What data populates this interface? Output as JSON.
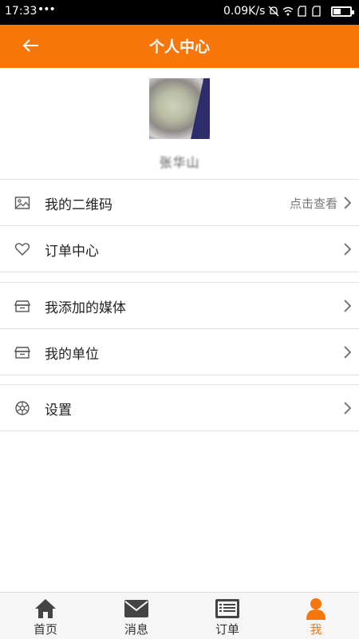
{
  "status_bar": {
    "time": "17:33",
    "dots": "•••",
    "net_speed": "0.09K/s"
  },
  "header": {
    "title": "个人中心",
    "back_icon": "arrow-left-icon"
  },
  "profile": {
    "username": "张华山"
  },
  "menu": [
    {
      "label": "我的二维码",
      "hint": "点击查看",
      "icon": "image-icon"
    },
    {
      "label": "订单中心",
      "icon": "heart-icon"
    },
    {
      "label": "我添加的媒体",
      "icon": "box-icon"
    },
    {
      "label": "我的单位",
      "icon": "box-icon"
    },
    {
      "label": "设置",
      "icon": "gear-icon"
    }
  ],
  "tabs": [
    {
      "label": "首页",
      "icon": "home-icon"
    },
    {
      "label": "消息",
      "icon": "envelope-icon"
    },
    {
      "label": "订单",
      "icon": "list-icon"
    },
    {
      "label": "我",
      "icon": "user-icon",
      "active": true
    }
  ],
  "colors": {
    "accent": "#f7760a",
    "statusbar": "#000000"
  }
}
